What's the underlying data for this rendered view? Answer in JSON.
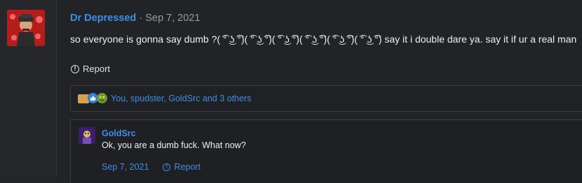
{
  "post": {
    "username": "Dr Depressed",
    "separator": "·",
    "date": "Sep 7, 2021",
    "message": "so everyone is gonna say dumb ?( ͡° ͜ʖ ͡°)( ͡° ͜ʖ ͡°)( ͡° ͜ʖ ͡°)( ͡° ͜ʖ ͡°)( ͡° ͜ʖ ͡°)( ͡° ͜ʖ ͡°) say it i double dare ya. say it if ur a real man",
    "report_label": "Report",
    "avatar_icon": "user-avatar"
  },
  "reactions": {
    "icons": [
      "folder-icon",
      "like-icon",
      "goblin-icon"
    ],
    "summary": "You, spudster, GoldSrc and 3 others"
  },
  "reply": {
    "username": "GoldSrc",
    "message": "Ok, you are a dumb fuck. What now?",
    "date": "Sep 7, 2021",
    "report_label": "Report"
  },
  "colors": {
    "link": "#3d8ee6",
    "background": "#222327",
    "text": "#f0f0f0"
  }
}
